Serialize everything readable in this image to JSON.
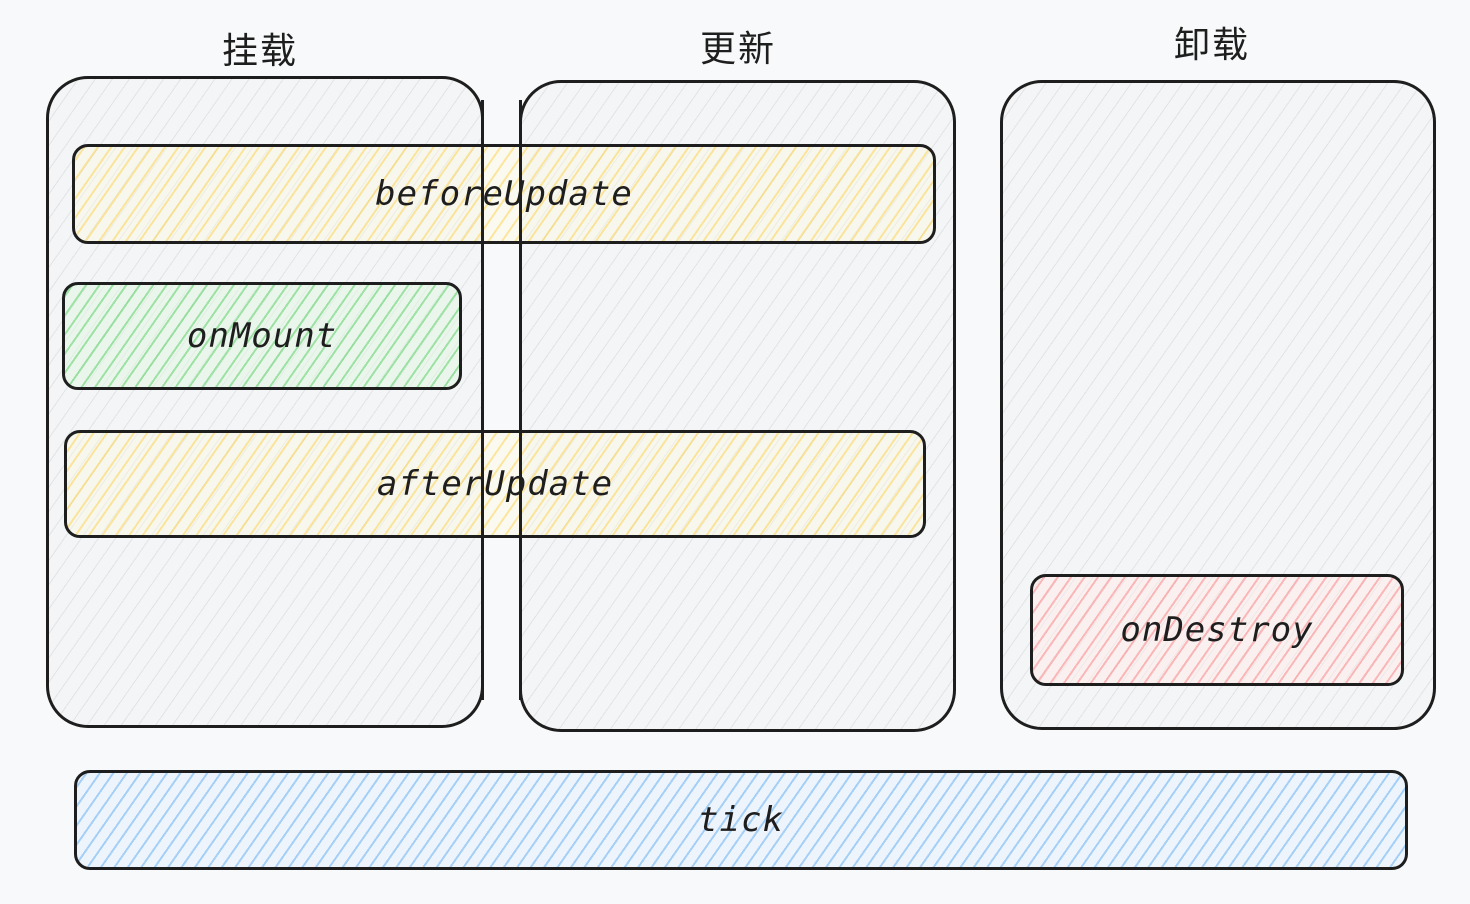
{
  "columns": {
    "mount": {
      "title": "挂载"
    },
    "update": {
      "title": "更新"
    },
    "unmount": {
      "title": "卸载"
    }
  },
  "hooks": {
    "before_update": {
      "label": "beforeUpdate",
      "color": "#ffd650"
    },
    "on_mount": {
      "label": "onMount",
      "color": "#6ed778"
    },
    "after_update": {
      "label": "afterUpdate",
      "color": "#ffd650"
    },
    "on_destroy": {
      "label": "onDestroy",
      "color": "#ff9696"
    },
    "tick": {
      "label": "tick",
      "color": "#78b9f5"
    }
  }
}
